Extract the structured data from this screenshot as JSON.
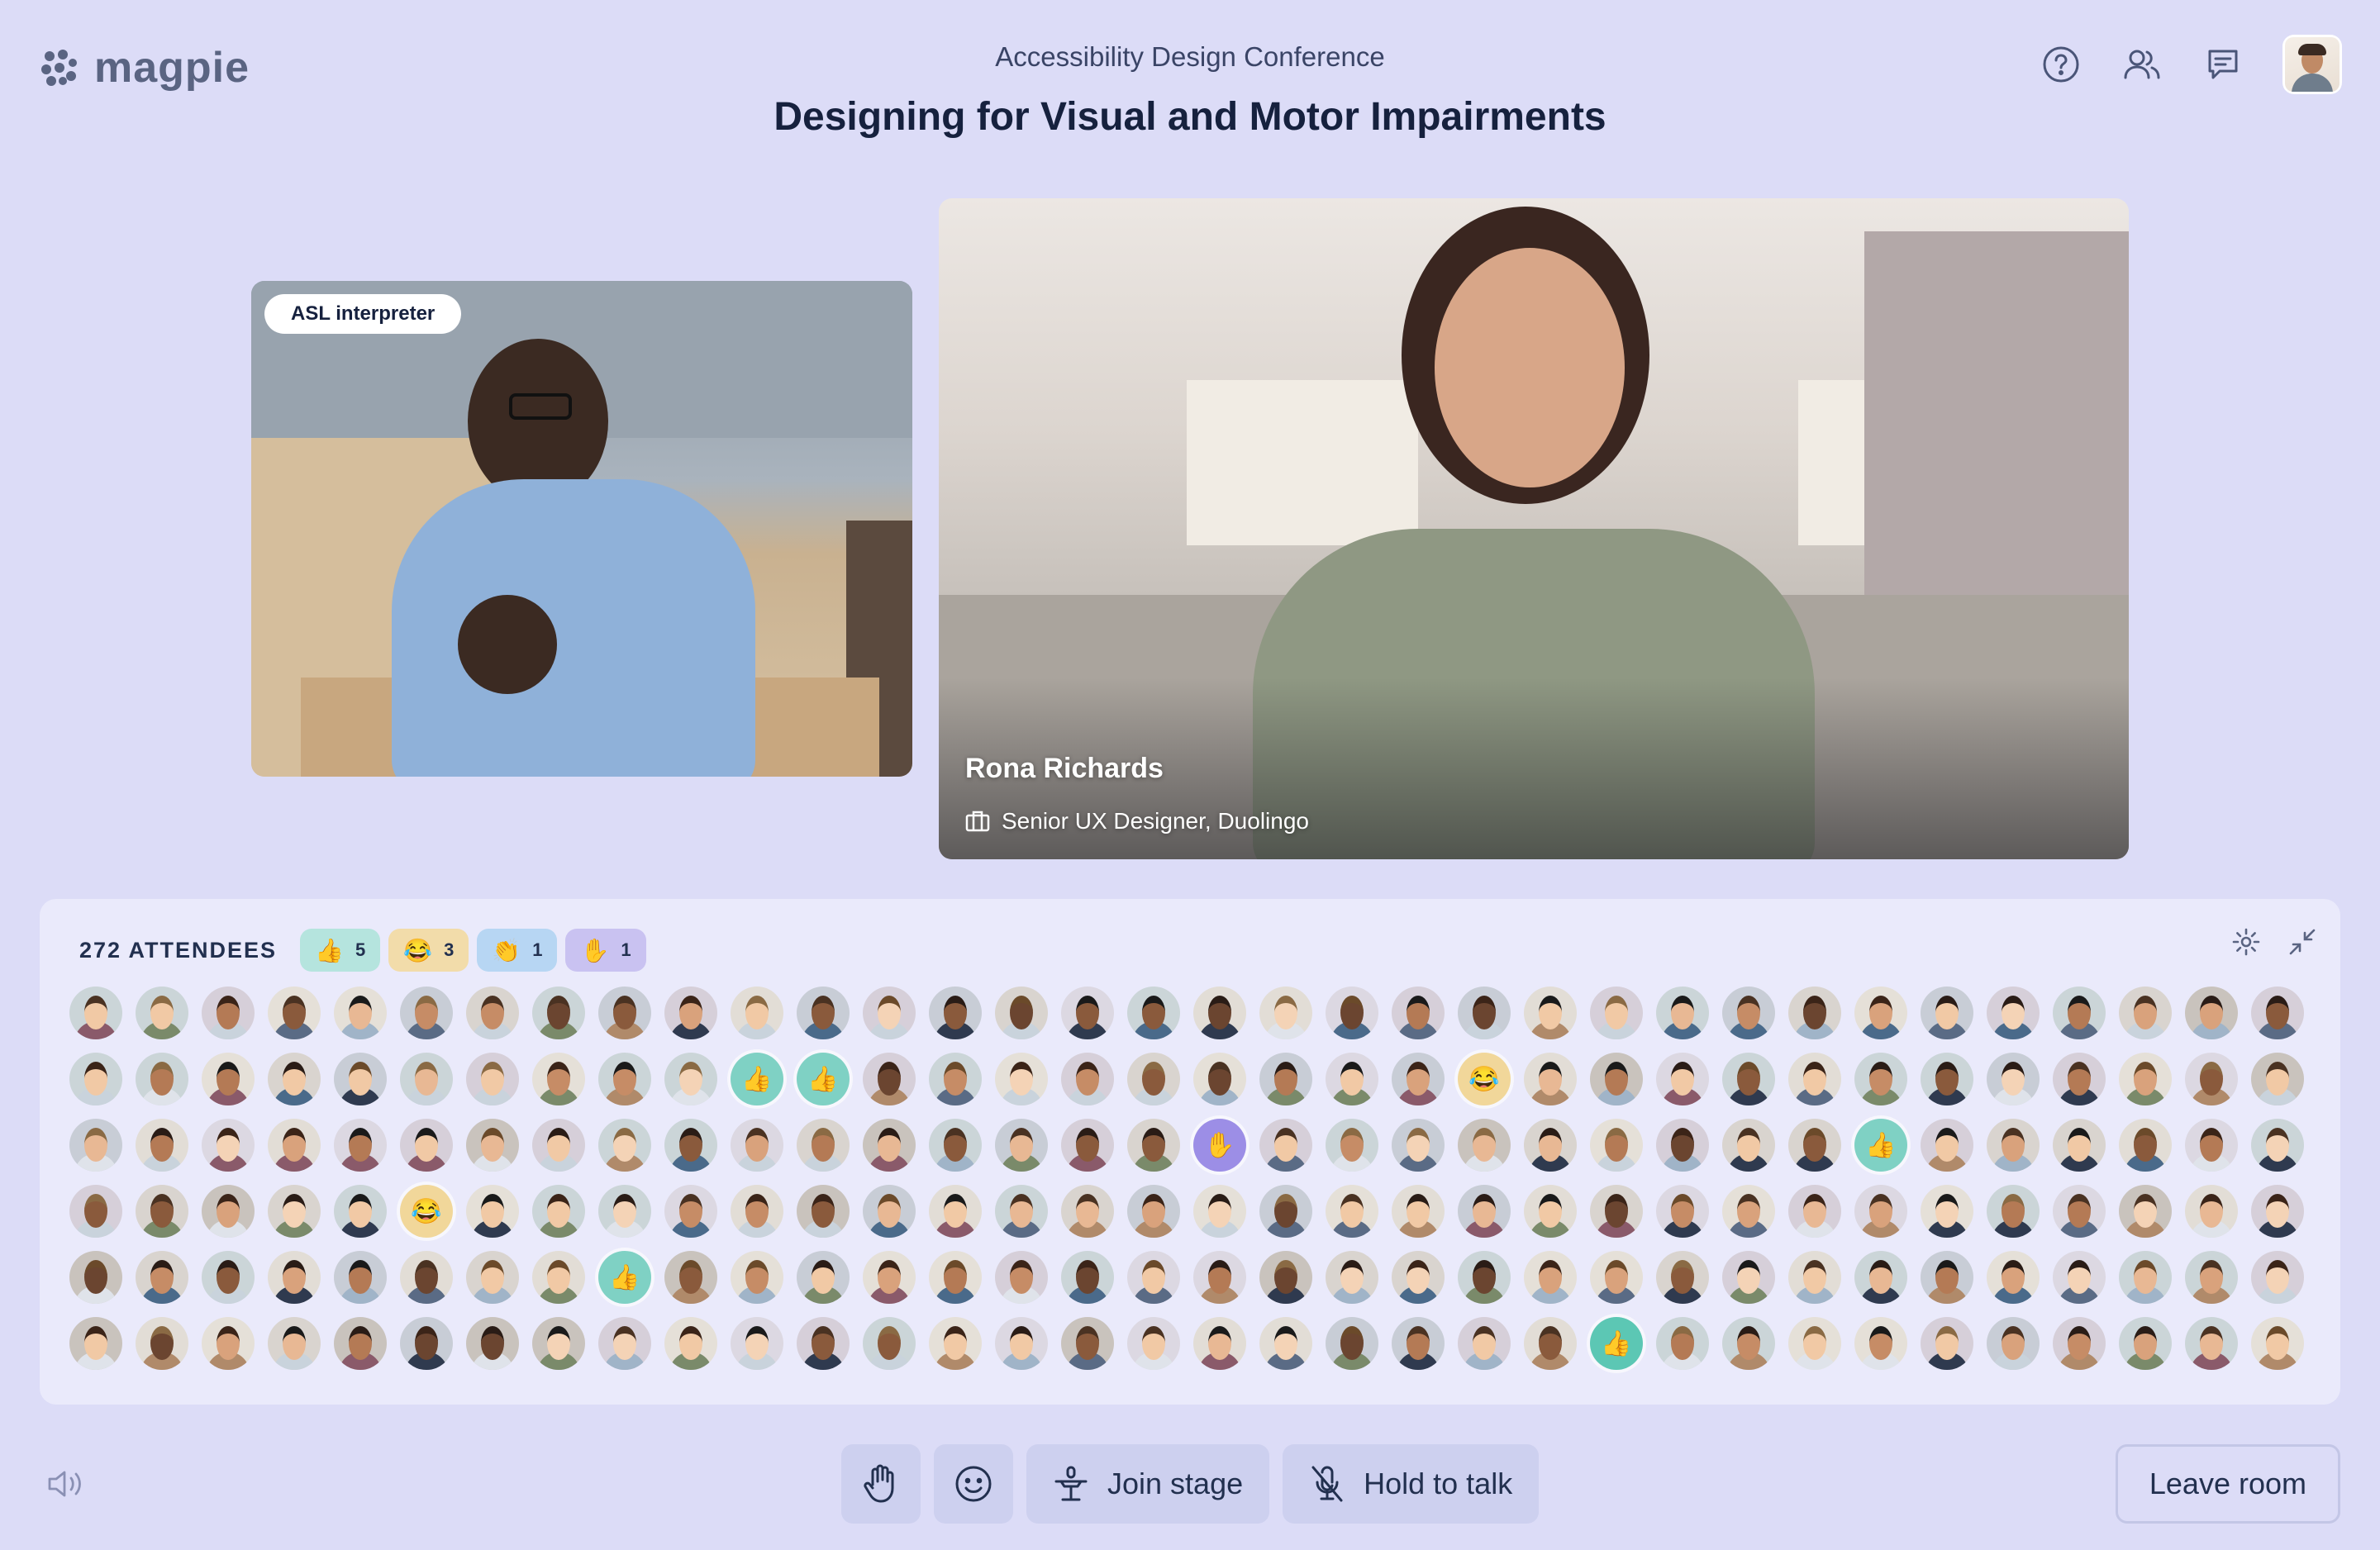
{
  "app": {
    "logo_text": "magpie"
  },
  "header": {
    "conference": "Accessibility Design Conference",
    "session_title": "Designing for Visual and Motor Impairments"
  },
  "icons": {
    "help": "help-icon",
    "people": "people-icon",
    "chat": "chat-icon"
  },
  "asl_tile": {
    "badge": "ASL interpreter"
  },
  "speaker": {
    "name": "Rona Richards",
    "role": "Senior UX Designer, Duolingo"
  },
  "attendees": {
    "count_label": "272 ATTENDEES",
    "reactions": [
      {
        "emoji": "👍",
        "count": "5",
        "color": "#b5e4de"
      },
      {
        "emoji": "😂",
        "count": "3",
        "color": "#f2dcaa"
      },
      {
        "emoji": "👏",
        "count": "1",
        "color": "#b7d6f3"
      },
      {
        "emoji": "✋",
        "count": "1",
        "color": "#c9c2f1"
      }
    ],
    "rows": 6,
    "cols": 34,
    "highlighted": [
      {
        "row": 1,
        "col": 10,
        "emoji": "👍",
        "color": "#7fd1c4"
      },
      {
        "row": 1,
        "col": 11,
        "emoji": "👍",
        "color": "#7fd1c4"
      },
      {
        "row": 1,
        "col": 21,
        "emoji": "😂",
        "color": "#f1d79a"
      },
      {
        "row": 2,
        "col": 17,
        "emoji": "✋",
        "color": "#9c8ee6"
      },
      {
        "row": 2,
        "col": 27,
        "emoji": "👍",
        "color": "#7fd1c4"
      },
      {
        "row": 3,
        "col": 5,
        "emoji": "😂",
        "color": "#f1d79a"
      },
      {
        "row": 4,
        "col": 8,
        "emoji": "👍",
        "color": "#7fd1c4"
      },
      {
        "row": 5,
        "col": 23,
        "emoji": "👍",
        "color": "#5cc7b4"
      }
    ]
  },
  "controls": {
    "raise_hand": "raise-hand-icon",
    "emoji": "smiley-icon",
    "join_stage": "Join stage",
    "hold_to_talk": "Hold to talk",
    "leave_room": "Leave room"
  }
}
